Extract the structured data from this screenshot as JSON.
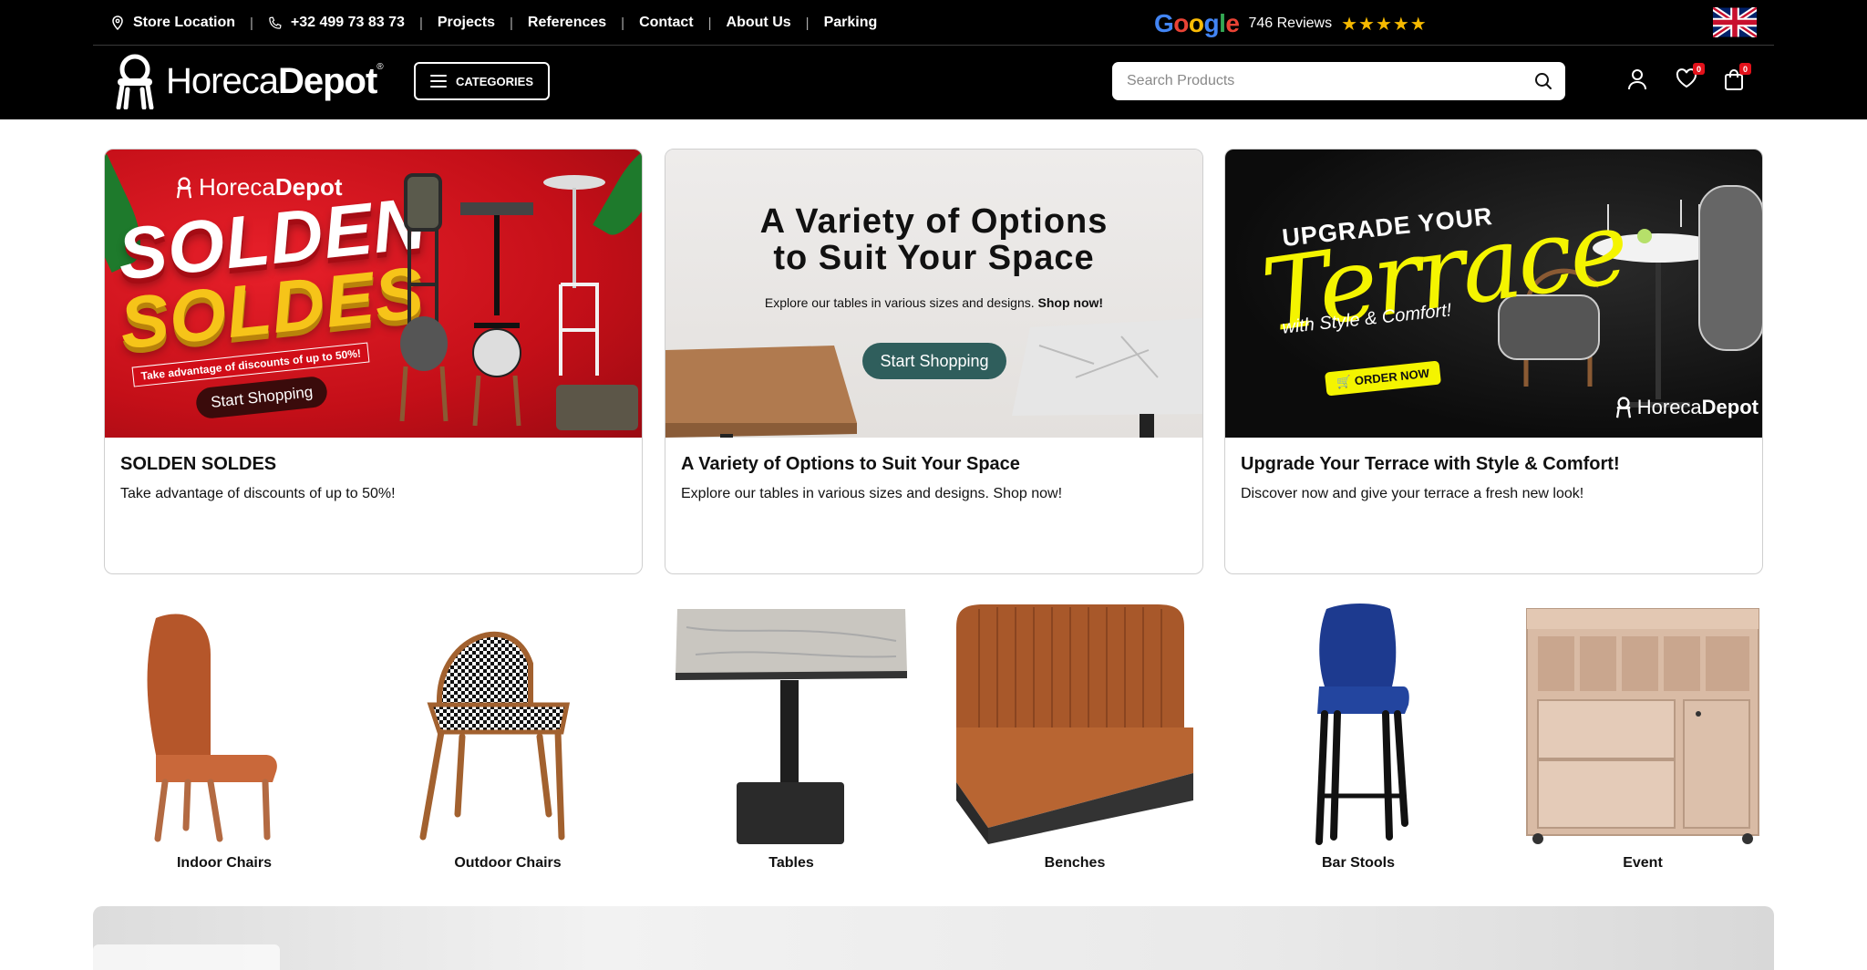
{
  "topbar": {
    "store_location": "Store Location",
    "phone": "+32 499 73 83 73",
    "projects": "Projects",
    "references": "References",
    "contact": "Contact",
    "about": "About Us",
    "parking": "Parking",
    "google_word": "Google",
    "reviews": "746 Reviews",
    "stars": "★★★★★",
    "language_flag": "uk-flag-icon"
  },
  "header": {
    "logo_light": "Horeca",
    "logo_bold": "Depot",
    "logo_reg": "®",
    "categories_label": "CATEGORIES",
    "search_placeholder": "Search Products",
    "wishlist_count": "0",
    "cart_count": "0"
  },
  "promos": [
    {
      "title": "SOLDEN SOLDES",
      "desc": "Take advantage of discounts of up to 50%!",
      "banner": {
        "logo_light": "Horeca",
        "logo_bold": "Depot",
        "line1": "SOLDEN",
        "line2": "SOLDES",
        "strip": "Take advantage of discounts of up to 50%!",
        "button": "Start Shopping"
      }
    },
    {
      "title": "A Variety of Options to Suit Your Space",
      "desc": "Explore our tables in various sizes and designs. Shop now!",
      "banner": {
        "line1": "A Variety of Options",
        "line2": "to Suit Your Space",
        "sub_plain": "Explore our tables in various sizes and designs. ",
        "sub_bold": "Shop now!",
        "button": "Start Shopping"
      }
    },
    {
      "title": "Upgrade Your Terrace with Style & Comfort!",
      "desc": "Discover now and give your terrace a fresh new look!",
      "banner": {
        "upgrade": "UPGRADE YOUR",
        "terrace": "Terrace",
        "with": "with Style & Comfort!",
        "button": "ORDER NOW",
        "logo_light": "Horeca",
        "logo_bold": "Depot"
      }
    }
  ],
  "categories": [
    {
      "label": "Indoor Chairs"
    },
    {
      "label": "Outdoor Chairs"
    },
    {
      "label": "Tables"
    },
    {
      "label": "Benches"
    },
    {
      "label": "Bar Stools"
    },
    {
      "label": "Event"
    }
  ],
  "colors": {
    "header_bg": "#000000",
    "badge": "#e3111a",
    "teal_button": "#2f5e5c",
    "terrace_yellow": "#f4f400",
    "solden_red": "#c40f18",
    "soldes_yellow": "#f6c419"
  }
}
